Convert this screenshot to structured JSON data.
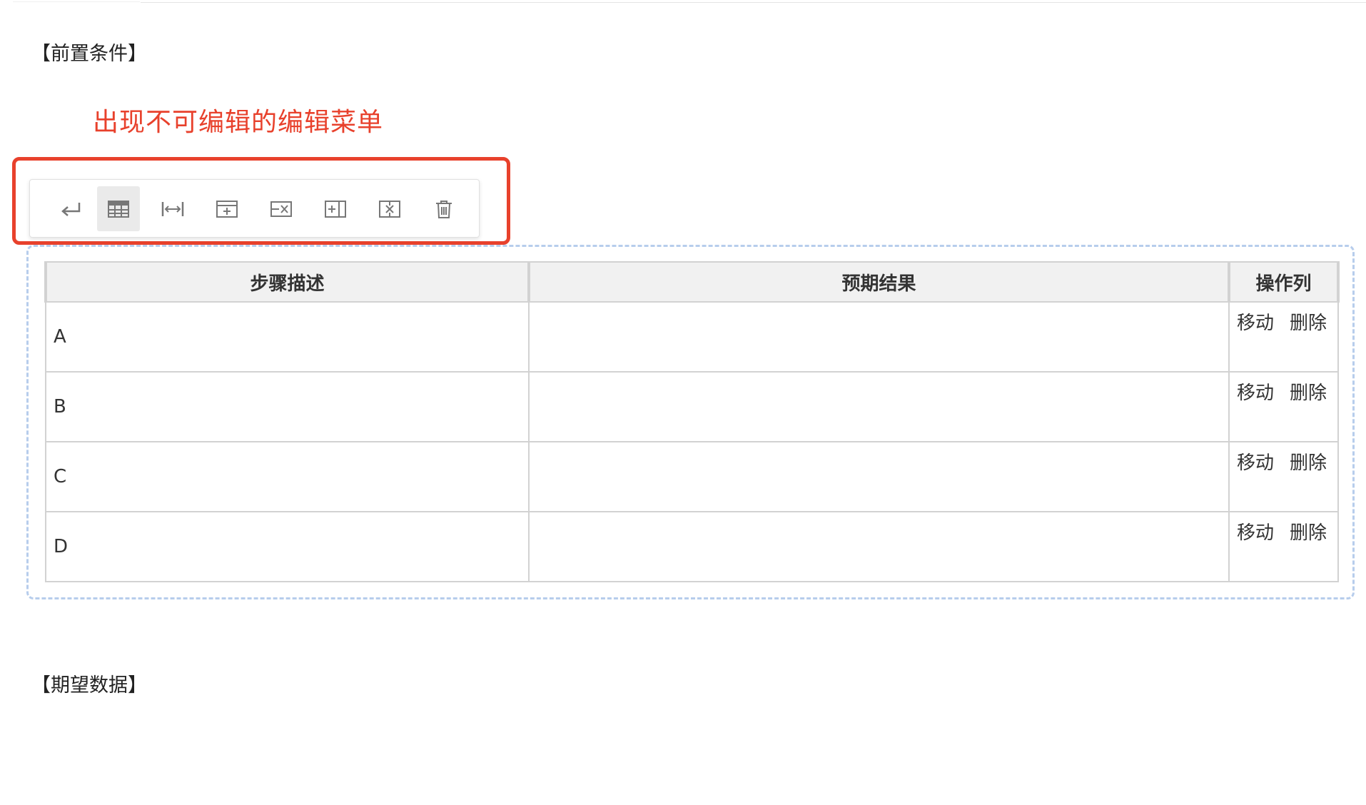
{
  "sections": {
    "precondition_title": "【前置条件】",
    "expected_data_title": "【期望数据】"
  },
  "annotation": {
    "text": "出现不可编辑的编辑菜单",
    "color": "#e8412c"
  },
  "toolbar": {
    "items": [
      {
        "icon": "enter-icon",
        "active": false
      },
      {
        "icon": "table-icon",
        "active": true
      },
      {
        "icon": "column-width-icon",
        "active": false
      },
      {
        "icon": "insert-row-icon",
        "active": false
      },
      {
        "icon": "delete-row-icon",
        "active": false
      },
      {
        "icon": "insert-column-icon",
        "active": false
      },
      {
        "icon": "delete-column-icon",
        "active": false
      },
      {
        "icon": "trash-icon",
        "active": false
      }
    ]
  },
  "table": {
    "headers": [
      "步骤描述",
      "预期结果",
      "操作列"
    ],
    "rows": [
      {
        "step": "A",
        "expected": "",
        "move": "移动",
        "delete": "删除"
      },
      {
        "step": "B",
        "expected": "",
        "move": "移动",
        "delete": "删除"
      },
      {
        "step": "C",
        "expected": "",
        "move": "移动",
        "delete": "删除"
      },
      {
        "step": "D",
        "expected": "",
        "move": "移动",
        "delete": "删除"
      }
    ]
  },
  "colors": {
    "annotation_red": "#e8412c",
    "table_frame_dashed": "#b7cdec",
    "header_bg": "#f1f1f1"
  }
}
